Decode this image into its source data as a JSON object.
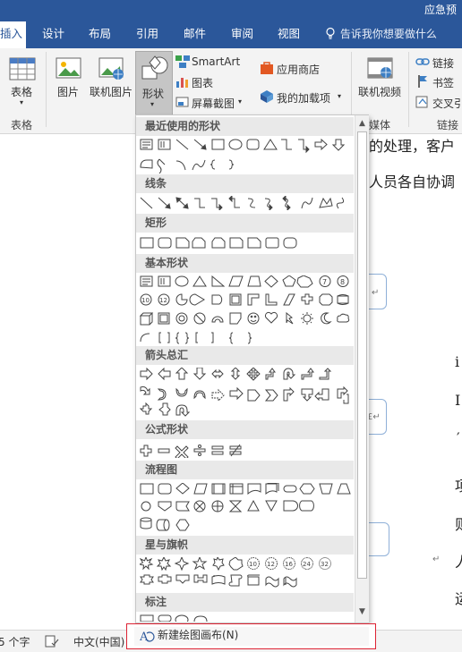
{
  "window": {
    "title": "应急预"
  },
  "tabs": [
    {
      "label": "插入",
      "active": true
    },
    {
      "label": "设计"
    },
    {
      "label": "布局"
    },
    {
      "label": "引用"
    },
    {
      "label": "邮件"
    },
    {
      "label": "审阅"
    },
    {
      "label": "视图"
    }
  ],
  "tell_me": "告诉我你想要做什么",
  "ribbon": {
    "table": "表格",
    "table_group": "表格",
    "picture": "图片",
    "online_picture": "联机图片",
    "shapes": "形状",
    "smartart": "SmartArt",
    "chart": "图表",
    "screenshot": "屏幕截图",
    "app_store": "应用商店",
    "my_addins": "我的加载项",
    "online_video": "联机视频",
    "media_group": "媒体",
    "link": "链接",
    "bookmark": "书签",
    "cross_ref": "交叉引",
    "links_group": "链接"
  },
  "document": {
    "line1": "的处理，客户",
    "line2": "人员各自协调",
    "frag_a": "i",
    "frag_b": "I",
    "frag_c": "′",
    "frag_d": "项",
    "frag_e": "则",
    "frag_f": "人",
    "frag_g": "运",
    "pmark": "↵"
  },
  "shapes_gallery": {
    "categories": [
      "最近使用的形状",
      "线条",
      "矩形",
      "基本形状",
      "箭头总汇",
      "公式形状",
      "流程图",
      "星与旗帜",
      "标注"
    ],
    "new_canvas": "新建绘图画布(N)"
  },
  "status": {
    "words": "5 个字",
    "language": "中文(中国)"
  },
  "colors": {
    "accent": "#2b579a",
    "highlight": "#dd2233"
  }
}
